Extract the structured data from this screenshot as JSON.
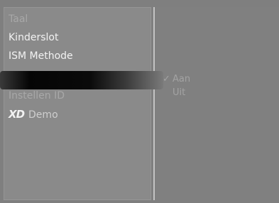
{
  "menu": {
    "items": [
      {
        "label": "Taal"
      },
      {
        "label": "Kinderslot"
      },
      {
        "label": "ISM Methode"
      },
      {
        "label": "Instellen ID"
      },
      {
        "label": "Demo",
        "logo_text": "XD"
      }
    ]
  },
  "options": {
    "check_mark": "✓",
    "items": [
      {
        "label": "Aan",
        "selected": true
      },
      {
        "label": "Uit",
        "selected": false
      }
    ]
  },
  "colors": {
    "panel_bg": "#8a8a8a",
    "highlight": "#0a0a0a",
    "text": "#f2f2f2",
    "option_text": "#a3a3a3"
  }
}
